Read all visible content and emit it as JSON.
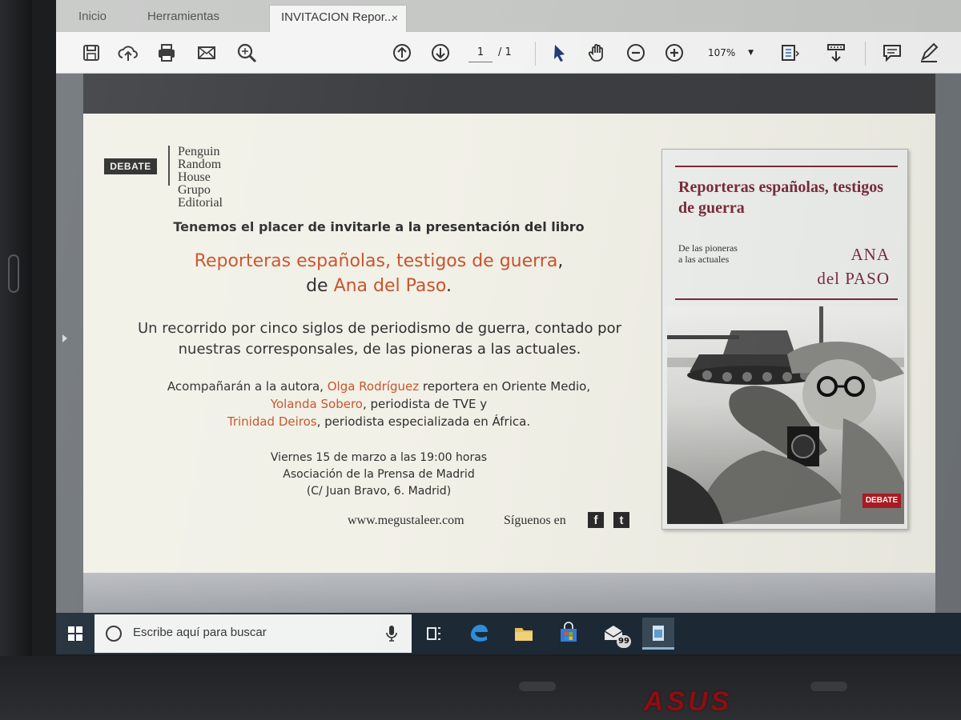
{
  "tabs": {
    "home": "Inicio",
    "tools": "Herramientas",
    "document": "INVITACION Repor...",
    "close": "×"
  },
  "toolbar": {
    "current_page": "1",
    "page_total": "/ 1",
    "zoom": "107%",
    "icons": [
      "save-icon",
      "upload-icon",
      "print-icon",
      "email-icon",
      "search-icon",
      "page-up-icon",
      "page-down-icon",
      "select-cursor-icon",
      "hand-tool-icon",
      "zoom-out-icon",
      "zoom-in-icon",
      "fit-page-icon",
      "scroll-mode-icon",
      "comment-icon",
      "sign-icon"
    ]
  },
  "invitation": {
    "logo_debate": "DEBATE",
    "logo_publisher": [
      "Penguin",
      "Random House",
      "Grupo Editorial"
    ],
    "intro": "Tenemos el placer de invitarle a la presentación del libro",
    "book_title": "Reporteras españolas, testigos de guerra",
    "title_suffix": ",",
    "author_prefix": "de ",
    "author": "Ana del Paso",
    "author_suffix": ".",
    "description": "Un recorrido por cinco siglos de periodismo de guerra, contado por nuestras corresponsales, de las pioneras a las actuales.",
    "companions_intro": "Acompañarán a la autora, ",
    "guest1_name": "Olga Rodríguez",
    "guest1_role": " reportera en Oriente Medio,",
    "guest2_name": "Yolanda Sobero",
    "guest2_role": ", periodista de TVE y",
    "guest3_name": "Trinidad Deiros",
    "guest3_role": ", periodista especializada en África.",
    "date": "Viernes 15 de marzo a las 19:00 horas",
    "venue": "Asociación de la Prensa de Madrid",
    "address": "(C/ Juan Bravo, 6. Madrid)",
    "website": "www.megustaleer.com",
    "follow": "Síguenos en",
    "facebook": "f",
    "twitter": "t"
  },
  "cover": {
    "title": "Reporteras españolas, testigos de guerra",
    "subtitle_line1": "De las pioneras",
    "subtitle_line2": "a las actuales",
    "author_line1": "ANA",
    "author_line2": "del PASO",
    "imprint": "DEBATE"
  },
  "taskbar": {
    "search_placeholder": "Escribe aquí para buscar",
    "mail_badge": "99"
  },
  "brand": "ASUS",
  "colors": {
    "accent": "#c9532a",
    "cover_title": "#7c2b3a",
    "taskbar": "#1d2a36"
  }
}
